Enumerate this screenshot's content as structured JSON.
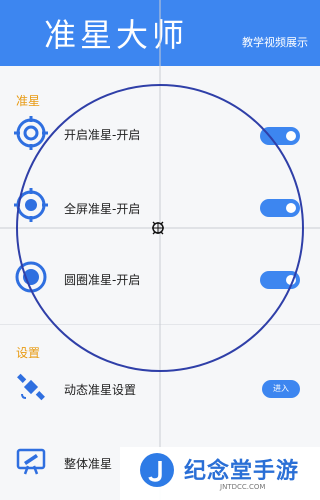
{
  "header": {
    "title": "准星大师",
    "tutorial_link": "教学视频展示"
  },
  "crosshair_section": {
    "title": "准星",
    "items": [
      {
        "label": "开启准星-开启",
        "icon": "crosshair-ring-icon",
        "toggle_on": true
      },
      {
        "label": "全屏准星-开启",
        "icon": "crosshair-filled-icon",
        "toggle_on": true
      },
      {
        "label": "圆圈准星-开启",
        "icon": "circle-dot-icon",
        "toggle_on": true
      }
    ]
  },
  "settings_section": {
    "title": "设置",
    "items": [
      {
        "label": "动态准星设置",
        "icon": "satellite-icon",
        "button_label": "进入"
      },
      {
        "label": "整体准星",
        "icon": "telescope-icon"
      }
    ]
  },
  "watermark": {
    "text": "纪念堂手游",
    "sub": "JNTDCC.COM"
  },
  "colors": {
    "accent": "#3d86f0",
    "section_title": "#e89b13",
    "overlay_circle": "#2f3fa8"
  }
}
